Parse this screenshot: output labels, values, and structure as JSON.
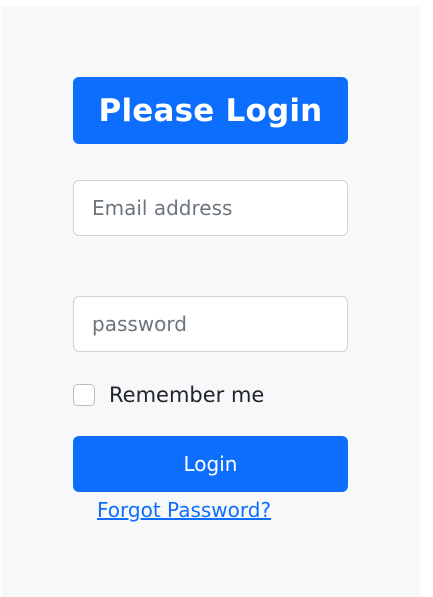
{
  "login_form": {
    "title": "Please Login",
    "email_placeholder": "Email address",
    "email_value": "",
    "password_placeholder": "password",
    "password_value": "",
    "remember_label": "Remember me",
    "remember_checked": false,
    "login_button_label": "Login",
    "forgot_password_link": "Forgot Password?"
  },
  "colors": {
    "primary": "#0d6efd",
    "panel_background": "#f7f8f9",
    "input_border": "#ced4da"
  }
}
